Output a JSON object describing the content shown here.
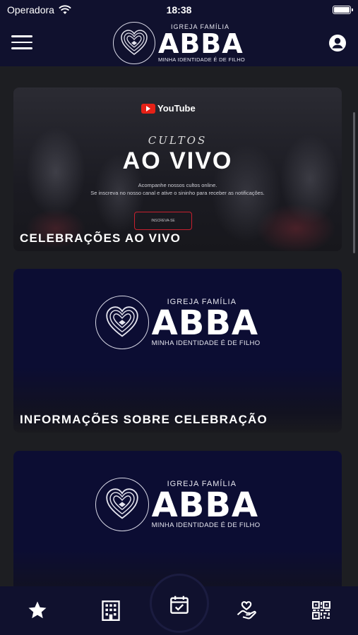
{
  "status_bar": {
    "carrier": "Operadora",
    "time": "18:38",
    "battery_level": 1.0
  },
  "header": {
    "logo": {
      "top": "IGREJA FAMÍLIA",
      "main": "ABBA",
      "sub": "MINHA IDENTIDADE É DE FILHO"
    },
    "menu_icon": "hamburger-icon",
    "profile_icon": "user-circle-icon"
  },
  "cards": [
    {
      "label": "CELEBRAÇÕES AO VIVO",
      "banner": {
        "platform": "YouTube",
        "overline": "CULTOS",
        "title": "AO VIVO",
        "desc_line1": "Acompanhe nossos cultos online.",
        "desc_line2": "Se inscreva no nosso canal e ative o sininho para receber as notificações.",
        "button": "INSCREVA-SE"
      }
    },
    {
      "label": "INFORMAÇÕES SOBRE CELEBRAÇÃO"
    },
    {
      "label": ""
    }
  ],
  "tabbar": {
    "tabs": [
      "star-icon",
      "building-icon",
      "calendar-check-icon",
      "heart-hand-icon",
      "qr-code-icon"
    ]
  },
  "colors": {
    "bar_bg": "#10112e",
    "card_dark": "#0c0d33",
    "content_bg": "#1d1e22",
    "accent_red": "#e62117"
  }
}
